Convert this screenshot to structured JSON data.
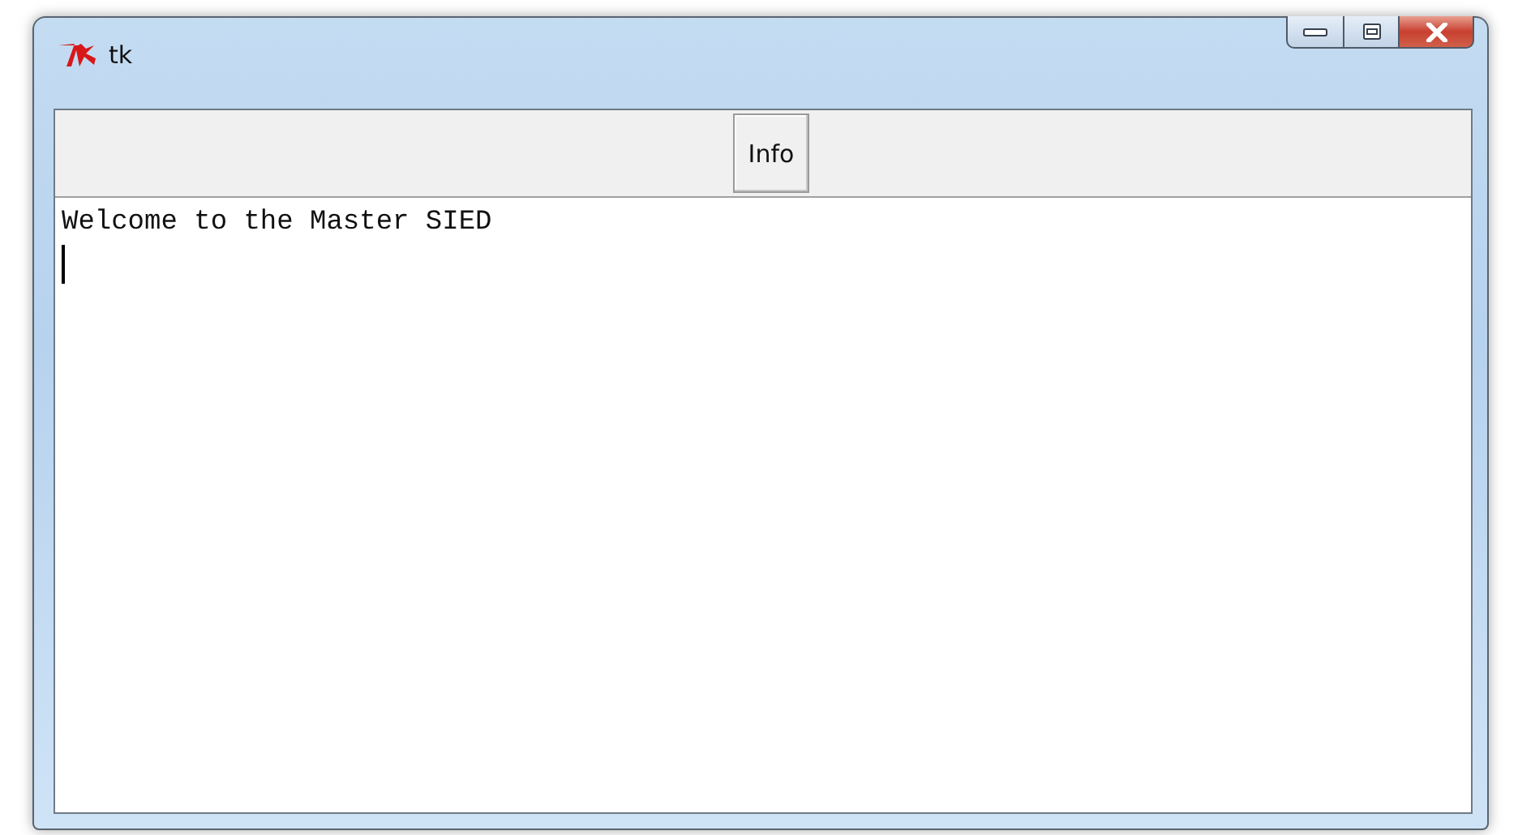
{
  "window": {
    "title": "tk"
  },
  "toolbar": {
    "buttons": [
      "Info"
    ]
  },
  "text_area": {
    "value": "Welcome to the Master SIED"
  }
}
